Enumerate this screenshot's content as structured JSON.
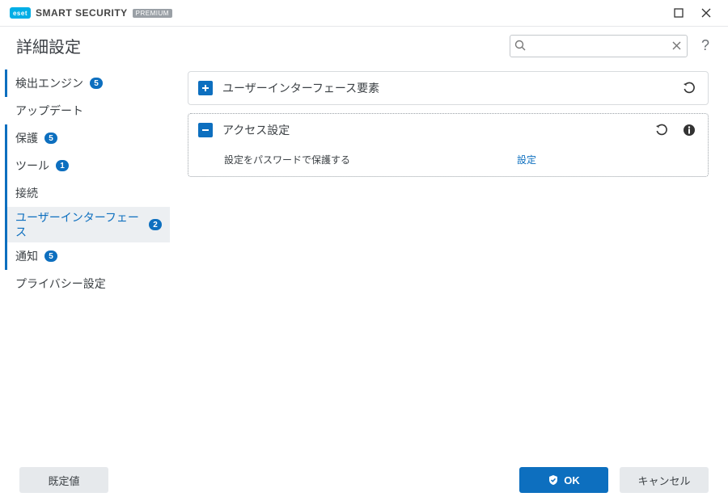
{
  "brand": {
    "logo_text": "eset",
    "name": "SMART SECURITY",
    "edition": "PREMIUM"
  },
  "page_title": "詳細設定",
  "search": {
    "placeholder": "",
    "value": ""
  },
  "help_glyph": "?",
  "sidebar": {
    "items": [
      {
        "label": "検出エンジン",
        "badge": "5",
        "hov": true
      },
      {
        "label": "アップデート"
      },
      {
        "label": "保護",
        "badge": "5",
        "hov": true
      },
      {
        "label": "ツール",
        "badge": "1",
        "hov": true
      },
      {
        "label": "接続",
        "hov": true
      },
      {
        "label": "ユーザーインターフェース",
        "badge": "2",
        "active": true
      },
      {
        "label": "通知",
        "badge": "5",
        "hov": true
      },
      {
        "label": "プライバシー設定"
      }
    ]
  },
  "panels": [
    {
      "expanded": false,
      "title": "ユーザーインターフェース要素",
      "undo": true
    },
    {
      "expanded": true,
      "title": "アクセス設定",
      "undo": true,
      "info": true,
      "rows": [
        {
          "label": "設定をパスワードで保護する",
          "link": "設定"
        }
      ]
    }
  ],
  "footer": {
    "defaults": "既定値",
    "ok": "OK",
    "cancel": "キャンセル"
  }
}
